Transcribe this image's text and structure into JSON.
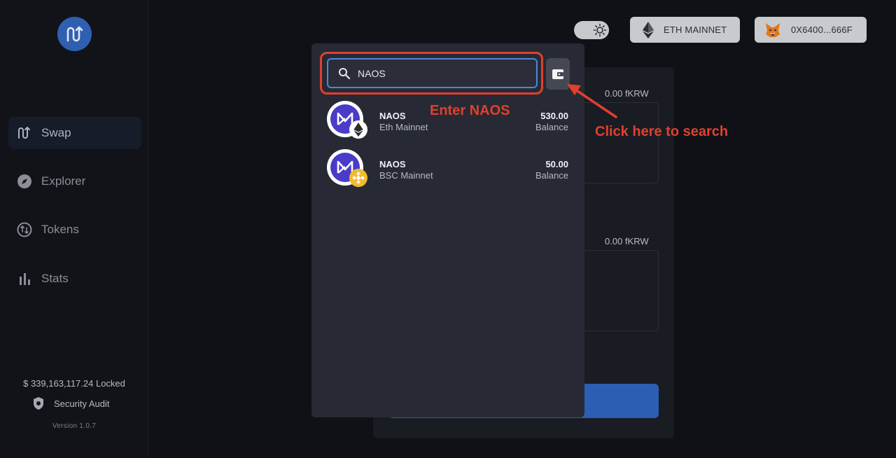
{
  "sidebar": {
    "items": [
      {
        "label": "Swap",
        "icon": "swap-icon",
        "active": true
      },
      {
        "label": "Explorer",
        "icon": "compass-icon",
        "active": false
      },
      {
        "label": "Tokens",
        "icon": "tokens-icon",
        "active": false
      },
      {
        "label": "Stats",
        "icon": "bar-chart-icon",
        "active": false
      }
    ],
    "locked": "$ 339,163,117.24 Locked",
    "audit": "Security Audit",
    "version": "Version 1.0.7"
  },
  "header": {
    "network": "ETH MAINNET",
    "wallet": "0X6400...666F"
  },
  "swap": {
    "from_balance": "0.00 fKRW",
    "to_balance": "0.00 fKRW"
  },
  "modal": {
    "search_value": "NAOS",
    "tokens": [
      {
        "name": "NAOS",
        "network": "Eth Mainnet",
        "amount": "530.00",
        "balance_label": "Balance"
      },
      {
        "name": "NAOS",
        "network": "BSC Mainnet",
        "amount": "50.00",
        "balance_label": "Balance"
      }
    ]
  },
  "annotations": {
    "enter": "Enter NAOS",
    "click": "Click here to search"
  },
  "colors": {
    "accent": "#2f5fb0",
    "highlight": "#e0402d",
    "naos": "#4a3cc8"
  }
}
